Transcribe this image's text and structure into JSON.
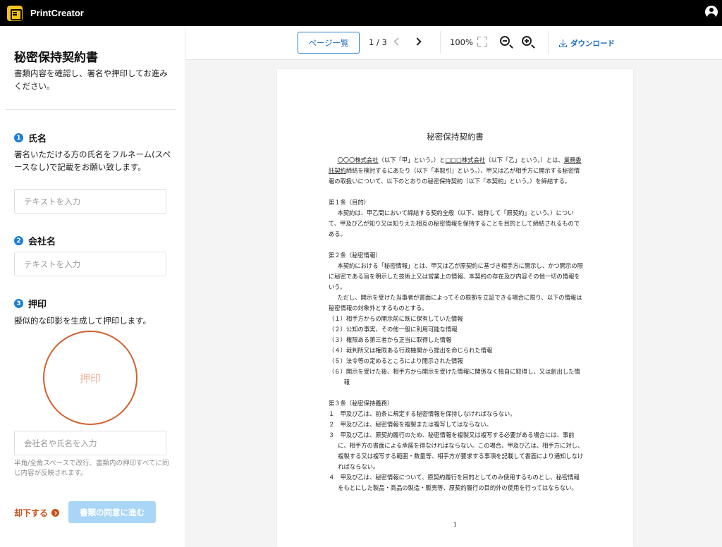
{
  "app": {
    "title": "PrintCreator"
  },
  "sidebar": {
    "title": "秘密保持契約書",
    "description": "書類内容を確認し、署名や押印してお進みください。",
    "steps": [
      {
        "number": "1",
        "label": "氏名",
        "description": "署名いただける方の氏名をフルネーム(スペースなし)で記載をお願い致します。",
        "placeholder": "テキストを入力"
      },
      {
        "number": "2",
        "label": "会社名",
        "placeholder": "テキストを入力"
      },
      {
        "number": "3",
        "label": "押印",
        "description": "擬似的な印影を生成して押印します。",
        "seal_text": "押印",
        "placeholder": "会社名や氏名を入力",
        "note": "半角/全角スペースで改行、書類内の押印すべてに同じ内容が反映されます。"
      }
    ],
    "reject_label": "却下する",
    "agree_label": "書類の同意に進む"
  },
  "toolbar": {
    "page_list_label": "ページ一覧",
    "page_indicator": "1 / 3",
    "zoom_level": "100%",
    "download_label": "ダウンロード"
  },
  "document": {
    "title": "秘密保持契約書",
    "party_a": "〇〇〇株式会社",
    "party_b": "□□□株式会社",
    "business": "業務委託契約",
    "preamble_1": "（以下「甲」という。）と",
    "preamble_2": "（以下「乙」という。）とは、",
    "preamble_3": "締結を検討するにあたり（以下「本取引」という。）、甲又は乙が相手方に開示する秘密情報の取扱いについて、以下のとおりの秘密保持契約（以下「本契約」という。）を締結する。",
    "article1_title": "第１条（目的）",
    "article1_text": "本契約は、甲乙間において締結する契約全般（以下、総称して「原契約」という。）について、甲及び乙が知り又は知りえた相互の秘密情報を保持することを目的として締結されるものである。",
    "article2_title": "第２条（秘密情報）",
    "article2_text": "本契約における「秘密情報」とは、甲又は乙が原契約に基づき相手方に開示し、かつ開示の際に秘密である旨を明示した技術上又は営業上の情報、本契約の存在及び内容その他一切の情報をいう。",
    "article2_text2": "ただし、開示を受けた当事者が書面によってその根拠を立証できる場合に限り、以下の情報は秘密情報の対象外とするものとする。",
    "article2_items": [
      "（１）相手方からの開示前に既に保有していた情報",
      "（２）公知の事実、その他一般に利用可能な情報",
      "（３）権限ある第三者から正当に取得した情報",
      "（４）裁判所又は権限ある行政機関から提出を命じられた情報",
      "（５）法令等の定めるところにより開示された情報",
      "（６）開示を受けた後、相手方から開示を受けた情報に関係なく独自に取得し、又は創出した情報"
    ],
    "article3_title": "第３条（秘密保持義務）",
    "article3_items": [
      "１　甲及び乙は、前条に規定する秘密情報を保持しなければならない。",
      "２　甲及び乙は、秘密情報を複製または複写してはならない。",
      "３　甲及び乙は、原契約履行のため、秘密情報を複製又は複写する必要がある場合には、事前に、相手方の書面による承諾を得なければならない。この場合、甲及び乙は、相手方に対し、複製する又は複写する範囲・数量等、相手方が要求する事項を記載して書面により通知しなければならない。",
      "４　甲及び乙は、秘密情報について、原契約履行を目的としてのみ使用するものとし、秘密情報をもとにした製品・商品の製造・販売等、原契約履行の目的外の使用を行ってはならない。"
    ],
    "page_number": "1"
  }
}
